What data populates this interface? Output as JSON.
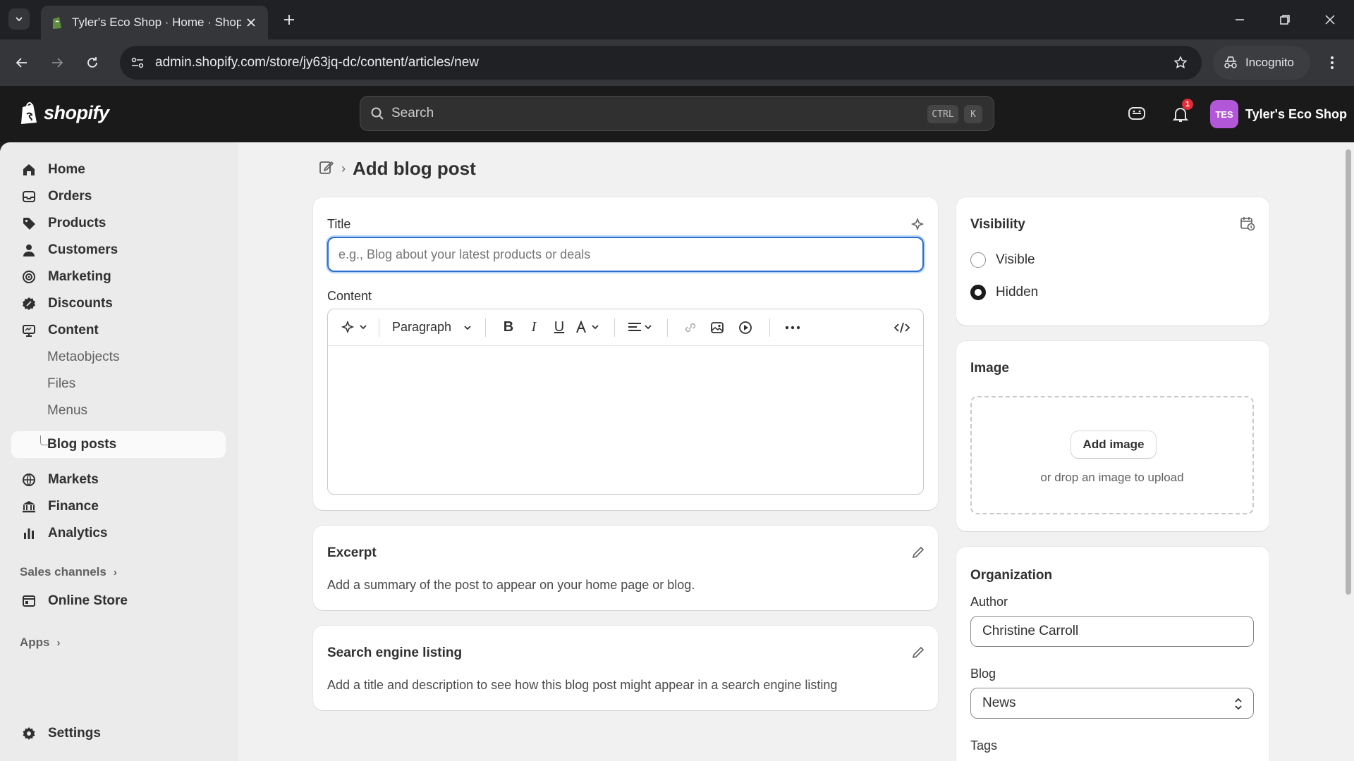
{
  "browser": {
    "tab_title": "Tyler's Eco Shop · Home · Shopify",
    "url": "admin.shopify.com/store/jy63jq-dc/content/articles/new",
    "incognito_label": "Incognito"
  },
  "topbar": {
    "logo_text": "shopify",
    "search_placeholder": "Search",
    "shortcut_ctrl": "CTRL",
    "shortcut_key": "K",
    "notification_count": "1",
    "store_initials": "TES",
    "store_name": "Tyler's Eco Shop"
  },
  "sidebar": {
    "items": [
      {
        "label": "Home",
        "icon": "home-icon"
      },
      {
        "label": "Orders",
        "icon": "inbox-icon"
      },
      {
        "label": "Products",
        "icon": "tag-icon"
      },
      {
        "label": "Customers",
        "icon": "person-icon"
      },
      {
        "label": "Marketing",
        "icon": "target-icon"
      },
      {
        "label": "Discounts",
        "icon": "discount-icon"
      },
      {
        "label": "Content",
        "icon": "monitor-icon"
      }
    ],
    "content_sub": [
      "Metaobjects",
      "Files",
      "Menus",
      "Blog posts"
    ],
    "items2": [
      {
        "label": "Markets",
        "icon": "globe-icon"
      },
      {
        "label": "Finance",
        "icon": "bank-icon"
      },
      {
        "label": "Analytics",
        "icon": "bar-chart-icon"
      }
    ],
    "sales_channels_label": "Sales channels",
    "online_store_label": "Online Store",
    "apps_label": "Apps",
    "settings_label": "Settings"
  },
  "page": {
    "title": "Add blog post"
  },
  "post_card": {
    "title_label": "Title",
    "title_placeholder": "e.g., Blog about your latest products or deals",
    "content_label": "Content",
    "paragraph_select": "Paragraph"
  },
  "excerpt_card": {
    "heading": "Excerpt",
    "text": "Add a summary of the post to appear on your home page or blog."
  },
  "seo_card": {
    "heading": "Search engine listing",
    "text": "Add a title and description to see how this blog post might appear in a search engine listing"
  },
  "visibility_card": {
    "heading": "Visibility",
    "options": [
      "Visible",
      "Hidden"
    ],
    "selected": "Hidden"
  },
  "image_card": {
    "heading": "Image",
    "button": "Add image",
    "hint": "or drop an image to upload"
  },
  "organization_card": {
    "heading": "Organization",
    "author_label": "Author",
    "author_value": "Christine Carroll",
    "blog_label": "Blog",
    "blog_value": "News",
    "tags_label": "Tags"
  },
  "colors": {
    "accent_focus": "#2c6ecb",
    "topbar_bg": "#1a1a1a",
    "badge_red": "#e22c38",
    "avatar_purple": "#b357d9"
  }
}
